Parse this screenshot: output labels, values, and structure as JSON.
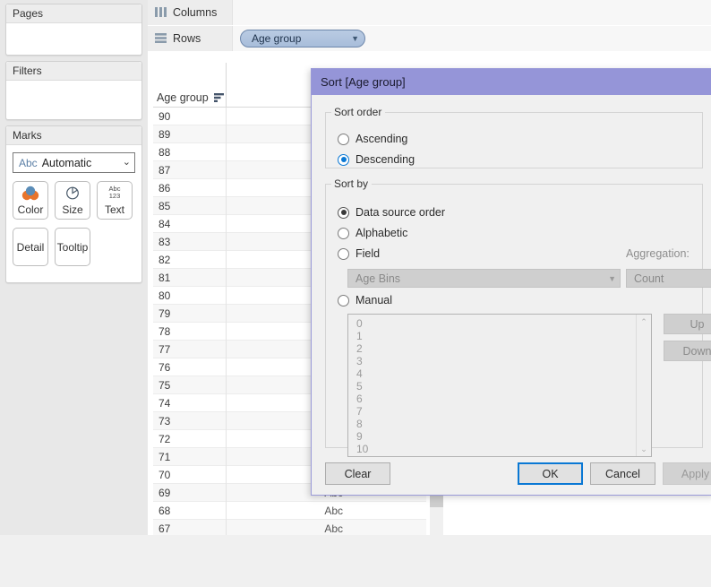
{
  "left_panel": {
    "pages": {
      "title": "Pages"
    },
    "filters": {
      "title": "Filters"
    },
    "marks": {
      "title": "Marks",
      "mark_type_prefix": "Abc",
      "mark_type": "Automatic",
      "chevron": "⌄",
      "buttons": [
        {
          "label": "Color",
          "icon": "color-circles-icon"
        },
        {
          "label": "Size",
          "icon": "size-circle-icon"
        },
        {
          "label": "Text",
          "icon": "abc-123-icon",
          "glyph_line1": "Abc",
          "glyph_line2": "123"
        },
        {
          "label": "Detail",
          "icon": "detail-icon"
        },
        {
          "label": "Tooltip",
          "icon": "tooltip-icon"
        }
      ]
    }
  },
  "shelves": {
    "columns": {
      "label": "Columns",
      "icon": "columns-icon",
      "pills": []
    },
    "rows": {
      "label": "Rows",
      "icon": "rows-icon",
      "pills": [
        {
          "label": "Age group",
          "chevron": "▼"
        }
      ]
    }
  },
  "table": {
    "column_header": "Age group",
    "sort_indicator_icon": "sort-descending-icon",
    "measure_text": "Abc",
    "rows": [
      "90",
      "89",
      "88",
      "87",
      "86",
      "85",
      "84",
      "83",
      "82",
      "81",
      "80",
      "79",
      "78",
      "77",
      "76",
      "75",
      "74",
      "73",
      "72",
      "71",
      "70",
      "69",
      "68",
      "67"
    ],
    "scrollbar": {
      "up_arrow": "⌃"
    }
  },
  "sort_dialog": {
    "title": "Sort [Age group]",
    "title_bar_color": "#9595d8",
    "sort_order": {
      "legend": "Sort order",
      "options": [
        {
          "label": "Ascending",
          "selected": false
        },
        {
          "label": "Descending",
          "selected": true
        }
      ]
    },
    "sort_by": {
      "legend": "Sort by",
      "options": [
        {
          "label": "Data source order",
          "selected": true
        },
        {
          "label": "Alphabetic",
          "selected": false
        },
        {
          "label": "Field",
          "selected": false
        },
        {
          "label": "Manual",
          "selected": false
        }
      ],
      "field_combo": {
        "value": "Age Bins",
        "disabled": true,
        "chevron": "▼"
      },
      "aggregation_label": "Aggregation:",
      "aggregation_combo": {
        "value": "Count",
        "disabled": true,
        "chevron": "▼"
      },
      "manual_list": {
        "items": [
          "0",
          "1",
          "2",
          "3",
          "4",
          "5",
          "6",
          "7",
          "8",
          "9",
          "10"
        ],
        "disabled": true,
        "scroll_up": "⌃",
        "scroll_down": "⌄"
      },
      "move_buttons": [
        {
          "label": "Up",
          "disabled": true
        },
        {
          "label": "Down",
          "disabled": true
        }
      ]
    },
    "footer_buttons": [
      {
        "label": "Clear",
        "disabled": false,
        "focused": false
      },
      {
        "label": "OK",
        "disabled": false,
        "focused": true
      },
      {
        "label": "Cancel",
        "disabled": false,
        "focused": false
      },
      {
        "label": "Apply",
        "disabled": true,
        "focused": false
      }
    ]
  }
}
